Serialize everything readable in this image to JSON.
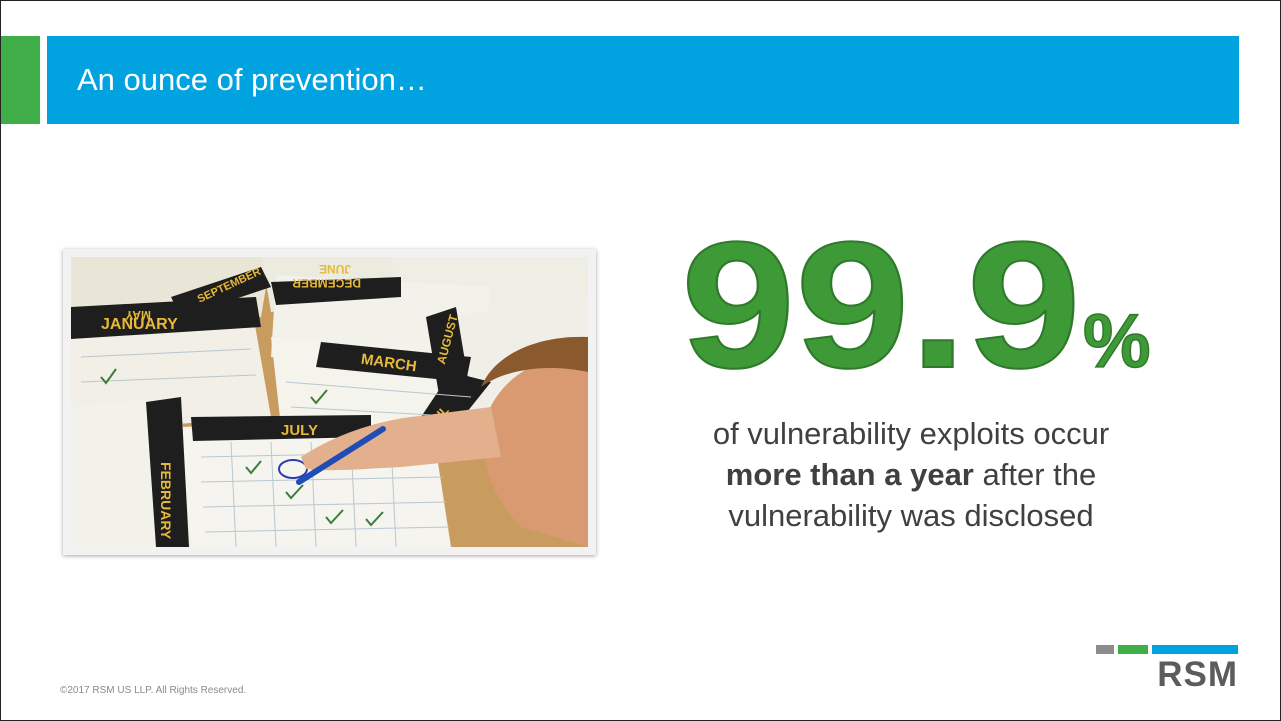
{
  "slide": {
    "title": "An ounce of prevention…",
    "stat": {
      "number": "99.9",
      "unit": "%"
    },
    "description": {
      "line1": "of vulnerability exploits occur",
      "bold": "more than a year",
      "after_bold": " after the",
      "line3": "vulnerability was disclosed"
    },
    "footer": {
      "copyright": "©2017 RSM US LLP. All Rights Reserved."
    },
    "logo": {
      "text": "RSM"
    },
    "photo": {
      "calendar_labels": [
        "MAY",
        "JANUARY",
        "SEPTEMBER",
        "DECEMBER",
        "JUNE",
        "MARCH",
        "AUGUST",
        "APRIL",
        "FEBRUARY",
        "JULY"
      ]
    }
  },
  "colors": {
    "header_blue": "#00a3e0",
    "accent_green": "#3fae49",
    "stat_green": "#3d9a37",
    "text_gray": "#404040",
    "calendar_gold": "#e8b83a"
  }
}
